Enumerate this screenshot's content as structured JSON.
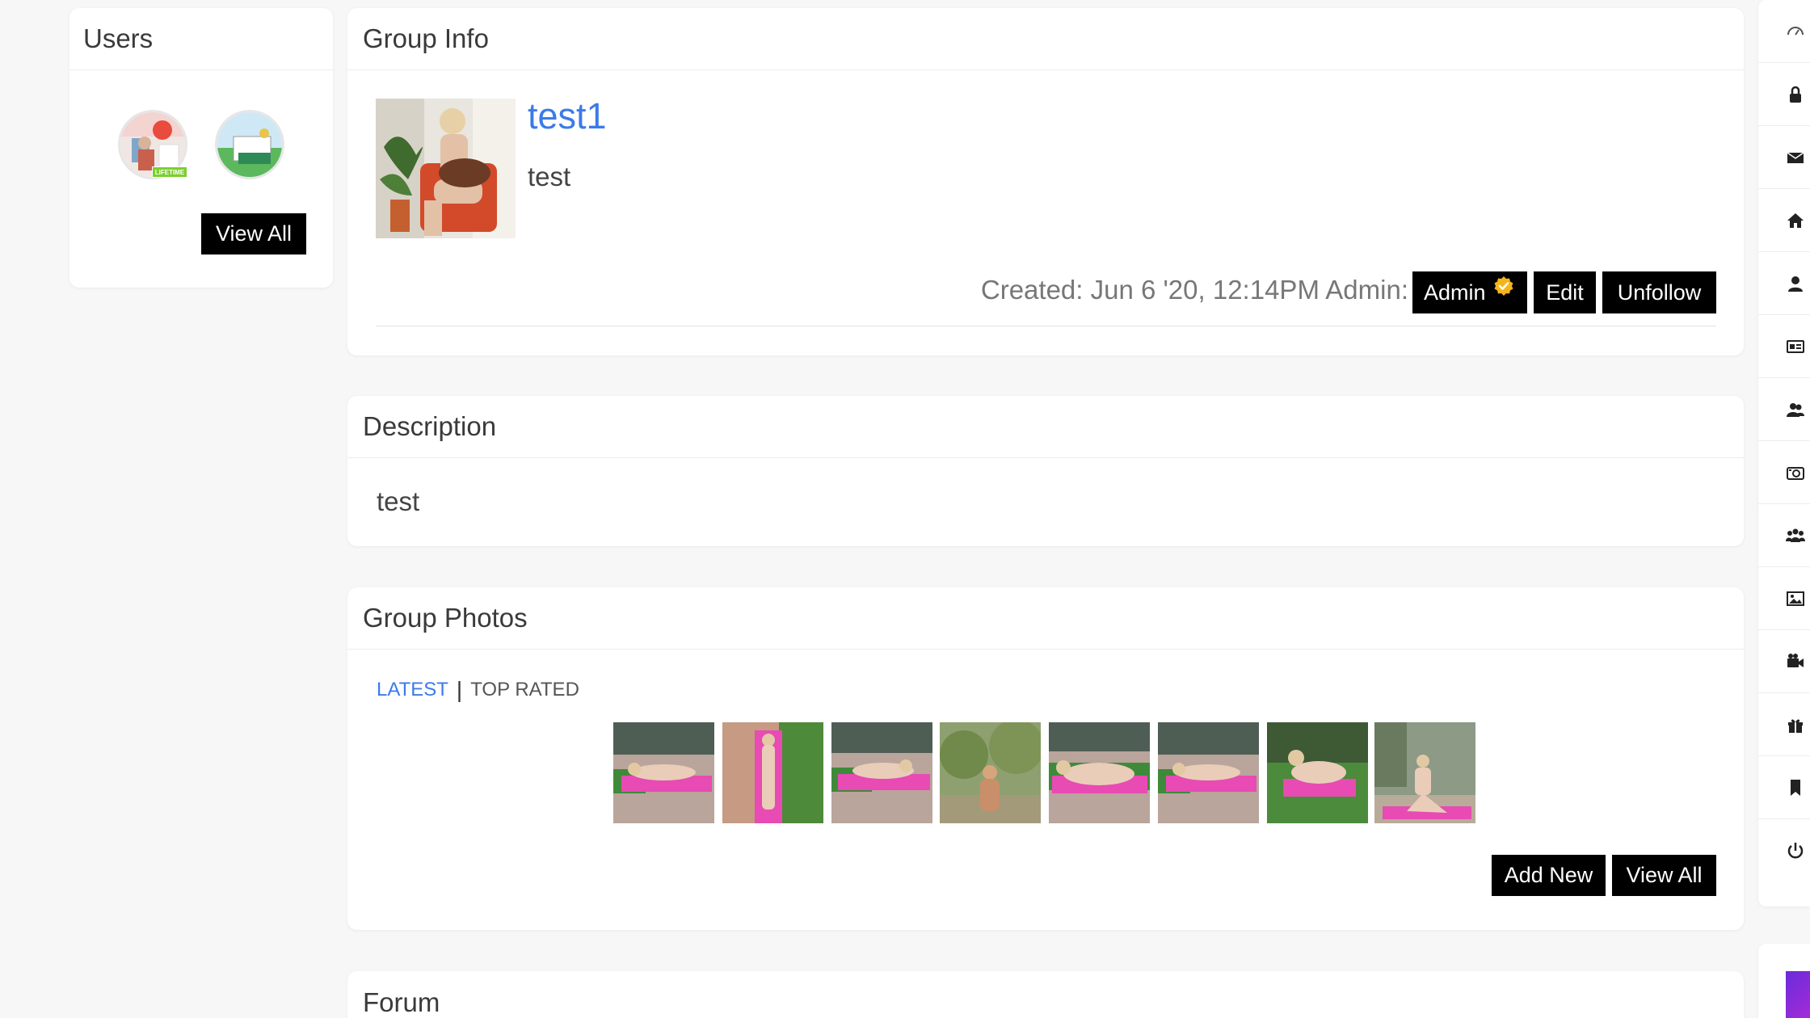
{
  "users_card": {
    "title": "Users",
    "badge": "LIFETIME",
    "view_all": "View All"
  },
  "group_info": {
    "title": "Group Info",
    "group_name": "test1",
    "short_desc": "test",
    "created": "Created: Jun 6 '20, 12:14PM Admin:",
    "admin_label": "Admin",
    "edit_label": "Edit",
    "unfollow_label": "Unfollow"
  },
  "description_card": {
    "title": "Description",
    "text": "test"
  },
  "photos_card": {
    "title": "Group Photos",
    "tab_latest": "LATEST",
    "separator": "|",
    "tab_top_rated": "TOP RATED",
    "add_new": "Add New",
    "view_all": "View All"
  },
  "forum_card": {
    "title": "Forum"
  },
  "side_rail": {
    "icons": [
      "dashboard-icon",
      "lock-icon",
      "envelope-icon",
      "home-icon",
      "user-icon",
      "id-card-icon",
      "users-icon",
      "camera-icon",
      "group-icon",
      "image-icon",
      "video-camera-icon",
      "gift-icon",
      "bookmark-icon",
      "power-icon"
    ]
  },
  "colors": {
    "link_blue": "#3b7be8",
    "button_black": "#000000",
    "verified_gold": "#f4b51c",
    "lifetime_green": "#7ccf2f",
    "yoga_mat": "#e84bb3"
  }
}
